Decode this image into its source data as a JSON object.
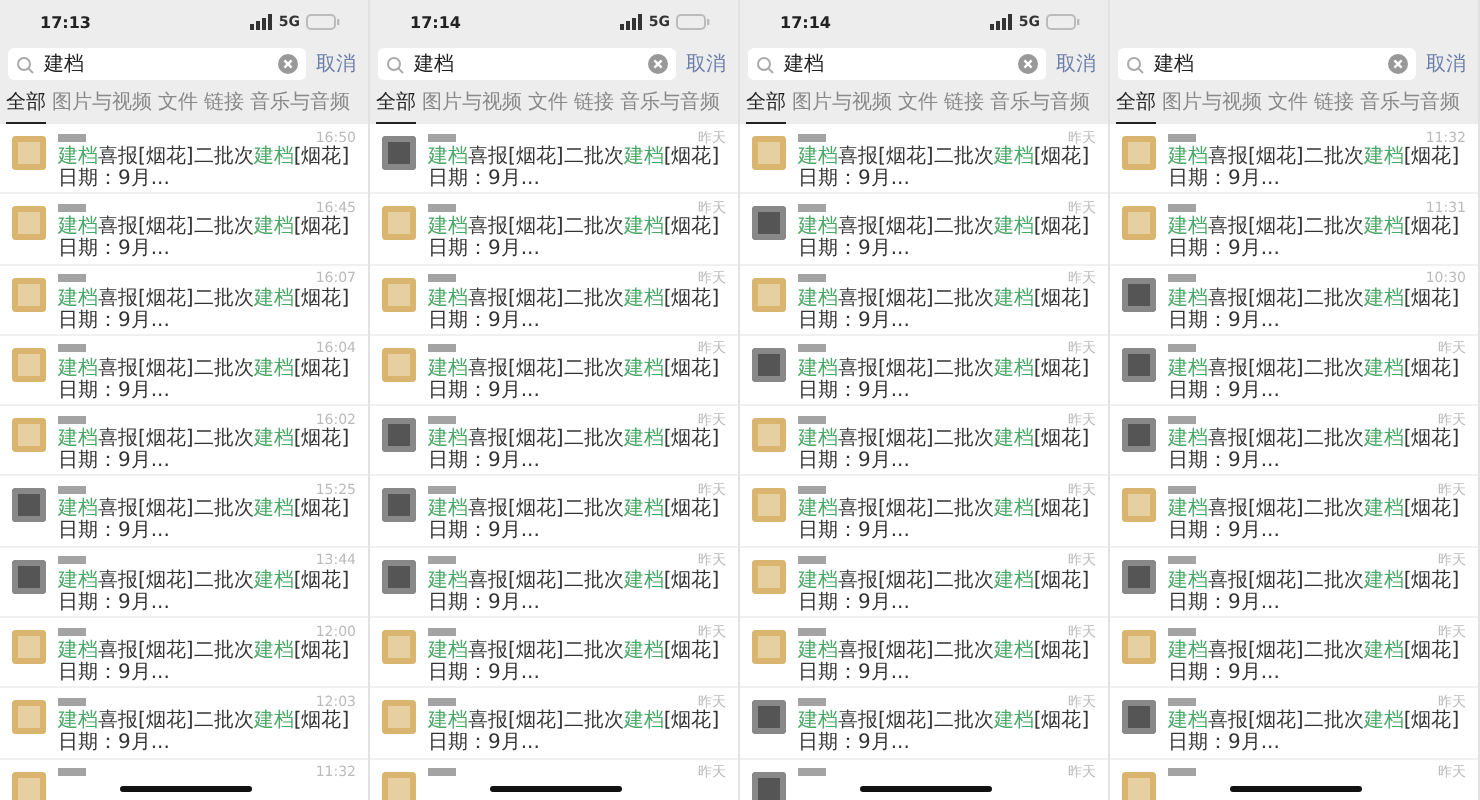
{
  "panels": [
    {
      "status_bar": {
        "time": "17:13",
        "network": "5G"
      },
      "search": {
        "query": "建档",
        "cancel": "取消"
      },
      "tabs": [
        {
          "label": "全部",
          "selected": true
        },
        {
          "label": "图片与视频",
          "selected": false
        },
        {
          "label": "文件",
          "selected": false
        },
        {
          "label": "链接",
          "selected": false
        },
        {
          "label": "音乐与音频",
          "selected": false
        }
      ],
      "results": [
        {
          "kind": "light",
          "time": "16:50",
          "message": [
            {
              "text": "建档",
              "highlight": true
            },
            {
              "text": "喜报[烟花]二批次",
              "highlight": false
            },
            {
              "text": "建档",
              "highlight": true
            },
            {
              "text": "[烟花]日期：9月...",
              "highlight": false
            }
          ]
        },
        {
          "kind": "light",
          "time": "16:45",
          "message": [
            {
              "text": "建档",
              "highlight": true
            },
            {
              "text": "喜报[烟花]二批次",
              "highlight": false
            },
            {
              "text": "建档",
              "highlight": true
            },
            {
              "text": "[烟花]日期：9月...",
              "highlight": false
            }
          ]
        },
        {
          "kind": "light",
          "time": "16:07",
          "message": [
            {
              "text": "建档",
              "highlight": true
            },
            {
              "text": "喜报[烟花]二批次",
              "highlight": false
            },
            {
              "text": "建档",
              "highlight": true
            },
            {
              "text": "[烟花]日期：9月...",
              "highlight": false
            }
          ]
        },
        {
          "kind": "light",
          "time": "16:04",
          "message": [
            {
              "text": "建档",
              "highlight": true
            },
            {
              "text": "喜报[烟花]二批次",
              "highlight": false
            },
            {
              "text": "建档",
              "highlight": true
            },
            {
              "text": "[烟花]日期：9月...",
              "highlight": false
            }
          ]
        },
        {
          "kind": "light",
          "time": "16:02",
          "message": [
            {
              "text": "建档",
              "highlight": true
            },
            {
              "text": "喜报[烟花]二批次",
              "highlight": false
            },
            {
              "text": "建档",
              "highlight": true
            },
            {
              "text": "[烟花]日期：9月...",
              "highlight": false
            }
          ]
        },
        {
          "kind": "dark",
          "time": "15:25",
          "message": [
            {
              "text": "建档",
              "highlight": true
            },
            {
              "text": "喜报[烟花]二批次",
              "highlight": false
            },
            {
              "text": "建档",
              "highlight": true
            },
            {
              "text": "[烟花]日期：9月...",
              "highlight": false
            }
          ]
        },
        {
          "kind": "dark",
          "time": "13:44",
          "message": [
            {
              "text": "建档",
              "highlight": true
            },
            {
              "text": "喜报[烟花]二批次",
              "highlight": false
            },
            {
              "text": "建档",
              "highlight": true
            },
            {
              "text": "[烟花]日期：9月...",
              "highlight": false
            }
          ]
        },
        {
          "kind": "light",
          "time": "12:00",
          "message": [
            {
              "text": "建档",
              "highlight": true
            },
            {
              "text": "喜报[烟花]二批次",
              "highlight": false
            },
            {
              "text": "建档",
              "highlight": true
            },
            {
              "text": "[烟花]日期：9月...",
              "highlight": false
            }
          ]
        },
        {
          "kind": "light",
          "time": "12:03",
          "message": [
            {
              "text": "建档",
              "highlight": true
            },
            {
              "text": "喜报[烟花]二批次",
              "highlight": false
            },
            {
              "text": "建档",
              "highlight": true
            },
            {
              "text": "[烟花]日期：9月...",
              "highlight": false
            }
          ]
        },
        {
          "kind": "light",
          "time": "11:32"
        }
      ]
    },
    {
      "status_bar": {
        "time": "17:14",
        "network": "5G"
      },
      "search": {
        "query": "建档",
        "cancel": "取消"
      },
      "tabs": [
        {
          "label": "全部",
          "selected": true
        },
        {
          "label": "图片与视频",
          "selected": false
        },
        {
          "label": "文件",
          "selected": false
        },
        {
          "label": "链接",
          "selected": false
        },
        {
          "label": "音乐与音频",
          "selected": false
        }
      ],
      "results": [
        {
          "kind": "dark",
          "time": "昨天",
          "message": [
            {
              "text": "建档",
              "highlight": true
            },
            {
              "text": "喜报[烟花]二批次",
              "highlight": false
            },
            {
              "text": "建档",
              "highlight": true
            },
            {
              "text": "[烟花]日期：9月...",
              "highlight": false
            }
          ]
        },
        {
          "kind": "light",
          "time": "昨天",
          "message": [
            {
              "text": "建档",
              "highlight": true
            },
            {
              "text": "喜报[烟花]二批次",
              "highlight": false
            },
            {
              "text": "建档",
              "highlight": true
            },
            {
              "text": "[烟花]日期：9月...",
              "highlight": false
            }
          ]
        },
        {
          "kind": "light",
          "time": "昨天",
          "message": [
            {
              "text": "建档",
              "highlight": true
            },
            {
              "text": "喜报[烟花]二批次",
              "highlight": false
            },
            {
              "text": "建档",
              "highlight": true
            },
            {
              "text": "[烟花]日期：9月...",
              "highlight": false
            }
          ]
        },
        {
          "kind": "light",
          "time": "昨天",
          "message": [
            {
              "text": "建档",
              "highlight": true
            },
            {
              "text": "喜报[烟花]二批次",
              "highlight": false
            },
            {
              "text": "建档",
              "highlight": true
            },
            {
              "text": "[烟花]日期：9月...",
              "highlight": false
            }
          ]
        },
        {
          "kind": "dark",
          "time": "昨天",
          "message": [
            {
              "text": "建档",
              "highlight": true
            },
            {
              "text": "喜报[烟花]二批次",
              "highlight": false
            },
            {
              "text": "建档",
              "highlight": true
            },
            {
              "text": "[烟花]日期：9月...",
              "highlight": false
            }
          ]
        },
        {
          "kind": "dark",
          "time": "昨天",
          "message": [
            {
              "text": "建档",
              "highlight": true
            },
            {
              "text": "喜报[烟花]二批次",
              "highlight": false
            },
            {
              "text": "建档",
              "highlight": true
            },
            {
              "text": "[烟花]日期：9月...",
              "highlight": false
            }
          ]
        },
        {
          "kind": "dark",
          "time": "昨天",
          "message": [
            {
              "text": "建档",
              "highlight": true
            },
            {
              "text": "喜报[烟花]二批次",
              "highlight": false
            },
            {
              "text": "建档",
              "highlight": true
            },
            {
              "text": "[烟花]日期：9月...",
              "highlight": false
            }
          ]
        },
        {
          "kind": "light",
          "time": "昨天",
          "message": [
            {
              "text": "建档",
              "highlight": true
            },
            {
              "text": "喜报[烟花]二批次",
              "highlight": false
            },
            {
              "text": "建档",
              "highlight": true
            },
            {
              "text": "[烟花]日期：9月...",
              "highlight": false
            }
          ]
        },
        {
          "kind": "light",
          "time": "昨天",
          "message": [
            {
              "text": "建档",
              "highlight": true
            },
            {
              "text": "喜报[烟花]二批次",
              "highlight": false
            },
            {
              "text": "建档",
              "highlight": true
            },
            {
              "text": "[烟花]日期：9月...",
              "highlight": false
            }
          ]
        },
        {
          "kind": "light",
          "time": "昨天"
        }
      ]
    },
    {
      "status_bar": {
        "time": "17:14",
        "network": "5G"
      },
      "search": {
        "query": "建档",
        "cancel": "取消"
      },
      "tabs": [
        {
          "label": "全部",
          "selected": true
        },
        {
          "label": "图片与视频",
          "selected": false
        },
        {
          "label": "文件",
          "selected": false
        },
        {
          "label": "链接",
          "selected": false
        },
        {
          "label": "音乐与音频",
          "selected": false
        }
      ],
      "results": [
        {
          "kind": "light",
          "time": "昨天",
          "message": [
            {
              "text": "建档",
              "highlight": true
            },
            {
              "text": "喜报[烟花]二批次",
              "highlight": false
            },
            {
              "text": "建档",
              "highlight": true
            },
            {
              "text": "[烟花]日期：9月...",
              "highlight": false
            }
          ]
        },
        {
          "kind": "dark",
          "time": "昨天",
          "message": [
            {
              "text": "建档",
              "highlight": true
            },
            {
              "text": "喜报[烟花]二批次",
              "highlight": false
            },
            {
              "text": "建档",
              "highlight": true
            },
            {
              "text": "[烟花]日期：9月...",
              "highlight": false
            }
          ]
        },
        {
          "kind": "light",
          "time": "昨天",
          "message": [
            {
              "text": "建档",
              "highlight": true
            },
            {
              "text": "喜报[烟花]二批次",
              "highlight": false
            },
            {
              "text": "建档",
              "highlight": true
            },
            {
              "text": "[烟花]日期：9月...",
              "highlight": false
            }
          ]
        },
        {
          "kind": "dark",
          "time": "昨天",
          "message": [
            {
              "text": "建档",
              "highlight": true
            },
            {
              "text": "喜报[烟花]二批次",
              "highlight": false
            },
            {
              "text": "建档",
              "highlight": true
            },
            {
              "text": "[烟花]日期：9月...",
              "highlight": false
            }
          ]
        },
        {
          "kind": "light",
          "time": "昨天",
          "message": [
            {
              "text": "建档",
              "highlight": true
            },
            {
              "text": "喜报[烟花]二批次",
              "highlight": false
            },
            {
              "text": "建档",
              "highlight": true
            },
            {
              "text": "[烟花]日期：9月...",
              "highlight": false
            }
          ]
        },
        {
          "kind": "light",
          "time": "昨天",
          "message": [
            {
              "text": "建档",
              "highlight": true
            },
            {
              "text": "喜报[烟花]二批次",
              "highlight": false
            },
            {
              "text": "建档",
              "highlight": true
            },
            {
              "text": "[烟花]日期：9月...",
              "highlight": false
            }
          ]
        },
        {
          "kind": "light",
          "time": "昨天",
          "message": [
            {
              "text": "建档",
              "highlight": true
            },
            {
              "text": "喜报[烟花]二批次",
              "highlight": false
            },
            {
              "text": "建档",
              "highlight": true
            },
            {
              "text": "[烟花]日期：9月...",
              "highlight": false
            }
          ]
        },
        {
          "kind": "light",
          "time": "昨天",
          "message": [
            {
              "text": "建档",
              "highlight": true
            },
            {
              "text": "喜报[烟花]二批次",
              "highlight": false
            },
            {
              "text": "建档",
              "highlight": true
            },
            {
              "text": "[烟花]日期：9月...",
              "highlight": false
            }
          ]
        },
        {
          "kind": "dark",
          "time": "昨天",
          "message": [
            {
              "text": "建档",
              "highlight": true
            },
            {
              "text": "喜报[烟花]二批次",
              "highlight": false
            },
            {
              "text": "建档",
              "highlight": true
            },
            {
              "text": "[烟花]日期：9月...",
              "highlight": false
            }
          ]
        },
        {
          "kind": "dark",
          "time": "昨天"
        }
      ]
    },
    {
      "search": {
        "query": "建档",
        "cancel": "取消"
      },
      "tabs": [
        {
          "label": "全部",
          "selected": true
        },
        {
          "label": "图片与视频",
          "selected": false
        },
        {
          "label": "文件",
          "selected": false
        },
        {
          "label": "链接",
          "selected": false
        },
        {
          "label": "音乐与音频",
          "selected": false
        }
      ],
      "results": [
        {
          "kind": "light",
          "time": "11:32",
          "message": [
            {
              "text": "建档",
              "highlight": true
            },
            {
              "text": "喜报[烟花]二批次",
              "highlight": false
            },
            {
              "text": "建档",
              "highlight": true
            },
            {
              "text": "[烟花]日期：9月...",
              "highlight": false
            }
          ]
        },
        {
          "kind": "light",
          "time": "11:31",
          "message": [
            {
              "text": "建档",
              "highlight": true
            },
            {
              "text": "喜报[烟花]二批次",
              "highlight": false
            },
            {
              "text": "建档",
              "highlight": true
            },
            {
              "text": "[烟花]日期：9月...",
              "highlight": false
            }
          ]
        },
        {
          "kind": "dark",
          "time": "10:30",
          "message": [
            {
              "text": "建档",
              "highlight": true
            },
            {
              "text": "喜报[烟花]二批次",
              "highlight": false
            },
            {
              "text": "建档",
              "highlight": true
            },
            {
              "text": "[烟花]日期：9月...",
              "highlight": false
            }
          ]
        },
        {
          "kind": "dark",
          "time": "昨天",
          "message": [
            {
              "text": "建档",
              "highlight": true
            },
            {
              "text": "喜报[烟花]二批次",
              "highlight": false
            },
            {
              "text": "建档",
              "highlight": true
            },
            {
              "text": "[烟花]日期：9月...",
              "highlight": false
            }
          ]
        },
        {
          "kind": "dark",
          "time": "昨天",
          "message": [
            {
              "text": "建档",
              "highlight": true
            },
            {
              "text": "喜报[烟花]二批次",
              "highlight": false
            },
            {
              "text": "建档",
              "highlight": true
            },
            {
              "text": "[烟花]日期：9月...",
              "highlight": false
            }
          ]
        },
        {
          "kind": "light",
          "time": "昨天",
          "message": [
            {
              "text": "建档",
              "highlight": true
            },
            {
              "text": "喜报[烟花]二批次",
              "highlight": false
            },
            {
              "text": "建档",
              "highlight": true
            },
            {
              "text": "[烟花]日期：9月...",
              "highlight": false
            }
          ]
        },
        {
          "kind": "dark",
          "time": "昨天",
          "message": [
            {
              "text": "建档",
              "highlight": true
            },
            {
              "text": "喜报[烟花]二批次",
              "highlight": false
            },
            {
              "text": "建档",
              "highlight": true
            },
            {
              "text": "[烟花]日期：9月...",
              "highlight": false
            }
          ]
        },
        {
          "kind": "light",
          "time": "昨天",
          "message": [
            {
              "text": "建档",
              "highlight": true
            },
            {
              "text": "喜报[烟花]二批次",
              "highlight": false
            },
            {
              "text": "建档",
              "highlight": true
            },
            {
              "text": "[烟花]日期：9月...",
              "highlight": false
            }
          ]
        },
        {
          "kind": "dark",
          "time": "昨天",
          "message": [
            {
              "text": "建档",
              "highlight": true
            },
            {
              "text": "喜报[烟花]二批次",
              "highlight": false
            },
            {
              "text": "建档",
              "highlight": true
            },
            {
              "text": "[烟花]日期：9月...",
              "highlight": false
            }
          ]
        },
        {
          "kind": "light",
          "time": "昨天"
        }
      ]
    }
  ]
}
